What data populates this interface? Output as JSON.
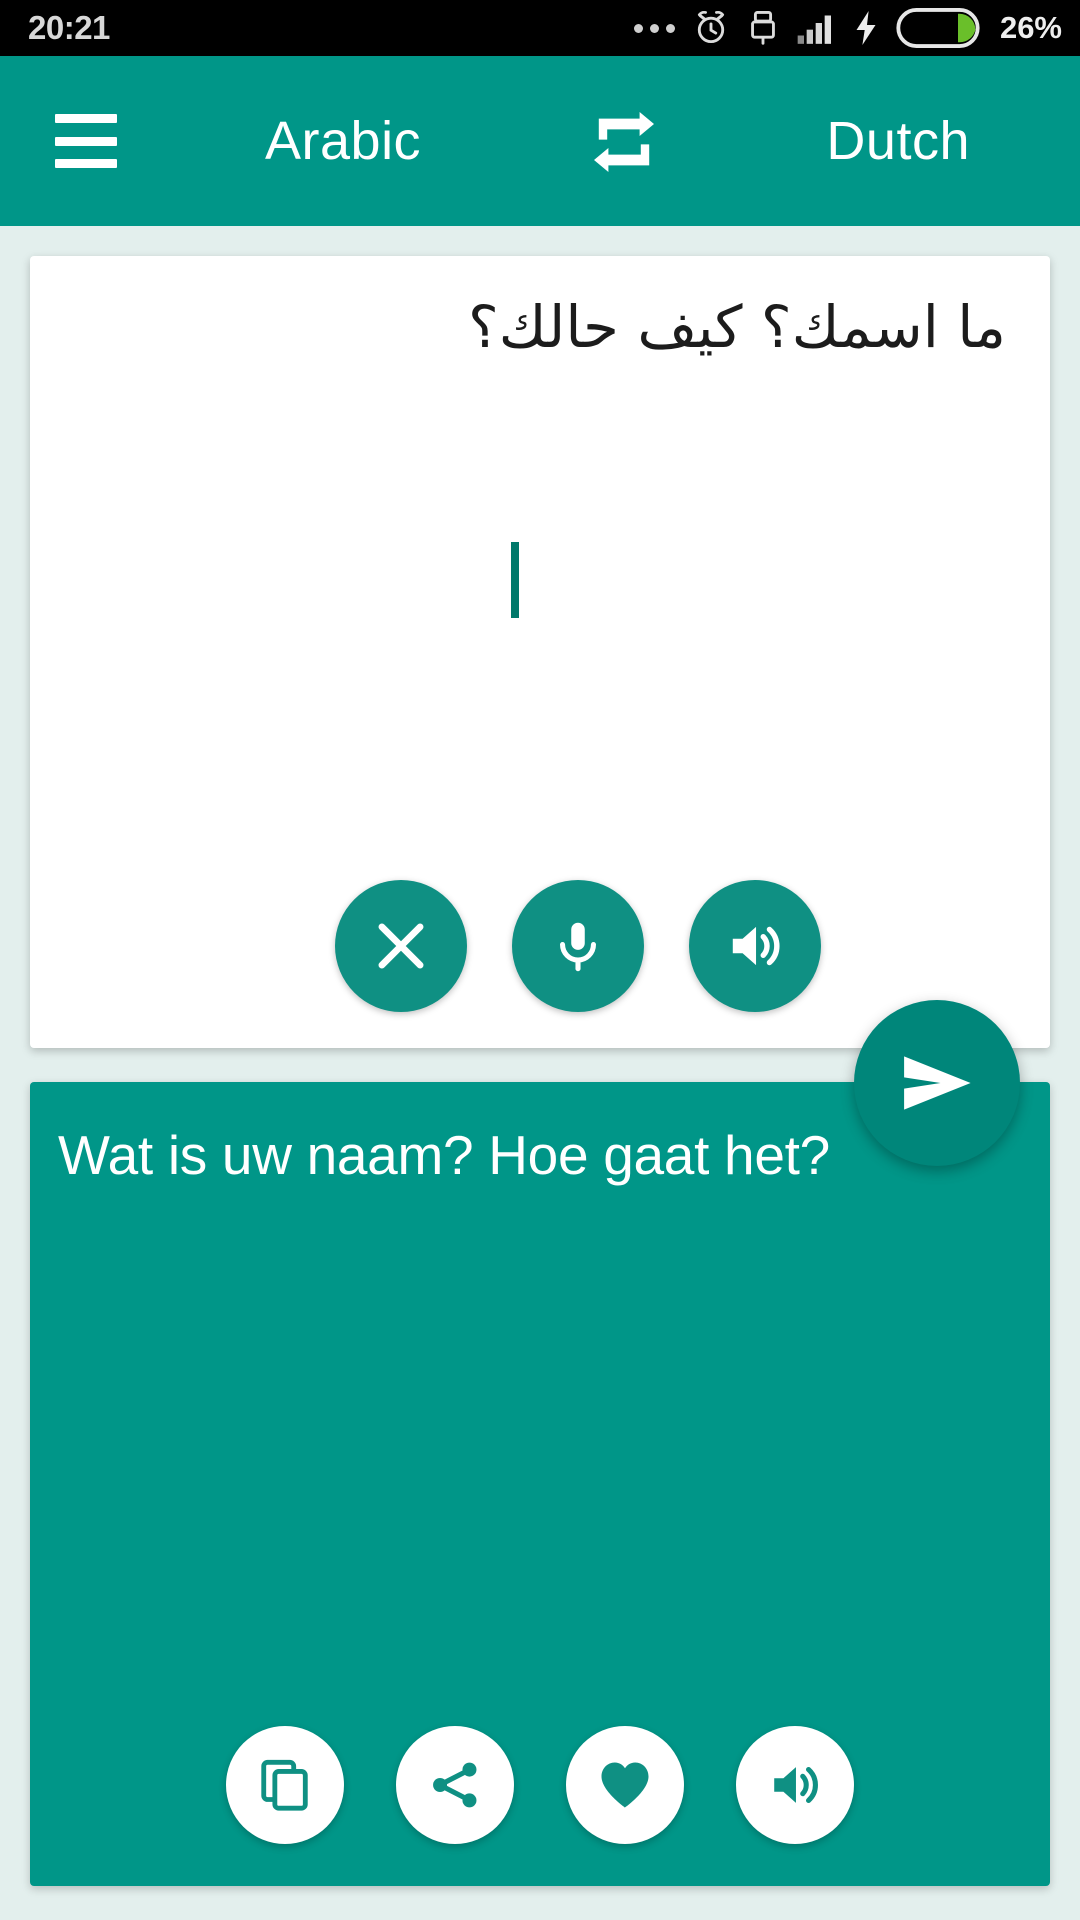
{
  "status_bar": {
    "time": "20:21",
    "battery_percent": "26%",
    "battery_level": 26,
    "icons": [
      "more-dots-icon",
      "alarm-icon",
      "usb-lock-icon",
      "signal-bars-icon",
      "charging-bolt-icon",
      "battery-icon"
    ],
    "background_color": "#000000",
    "text_color": "#d8d8d8",
    "battery_fill_color": "#6abf2a"
  },
  "app_bar": {
    "menu_label": "menu-icon",
    "source_language": "Arabic",
    "target_language": "Dutch",
    "swap_label": "swap-languages-icon",
    "background_color": "#009688",
    "text_color": "#ffffff"
  },
  "source": {
    "text": "ما اسمك؟ كيف حالك؟",
    "language": "Arabic",
    "direction": "rtl",
    "caret_visible": true,
    "background_color": "#ffffff",
    "text_color": "#1c1c1c",
    "actions": [
      {
        "name": "clear-button",
        "icon": "close-icon"
      },
      {
        "name": "voice-input-button",
        "icon": "microphone-icon"
      },
      {
        "name": "speak-source-button",
        "icon": "speaker-icon"
      }
    ]
  },
  "send_button": {
    "name": "translate-send-button",
    "icon": "send-icon",
    "color": "#00867a"
  },
  "target": {
    "text": "Wat is uw naam? Hoe gaat het?",
    "language": "Dutch",
    "background_color": "#009688",
    "text_color": "#ffffff",
    "actions": [
      {
        "name": "copy-button",
        "icon": "copy-icon"
      },
      {
        "name": "share-button",
        "icon": "share-icon"
      },
      {
        "name": "favorite-button",
        "icon": "heart-icon"
      },
      {
        "name": "speak-translation-button",
        "icon": "speaker-icon"
      }
    ]
  },
  "page": {
    "background_color": "#e3efed"
  }
}
